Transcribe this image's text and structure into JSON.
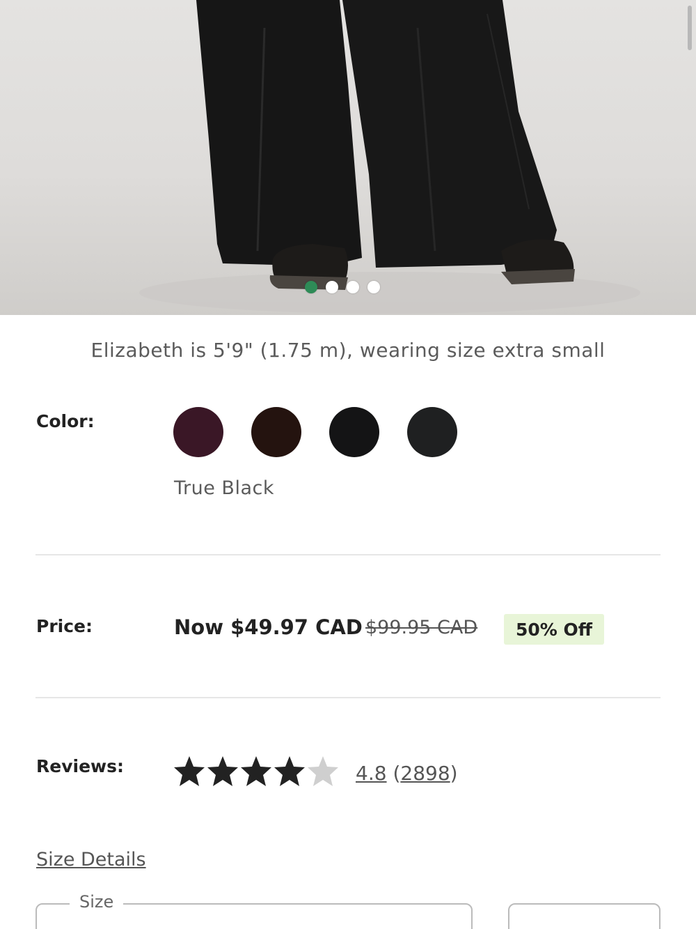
{
  "product_image": {
    "alt_label": "product-photo",
    "carousel": {
      "total": 4,
      "active": 1
    }
  },
  "caption": "Elizabeth is 5'9\" (1.75 m), wearing size extra small",
  "color": {
    "label": "Color:",
    "selected_name": "True Black",
    "swatches": [
      {
        "name": "plum",
        "hex": "#3a1726"
      },
      {
        "name": "brown",
        "hex": "#24130f"
      },
      {
        "name": "True Black",
        "hex": "#141415",
        "selected": true
      },
      {
        "name": "charcoal",
        "hex": "#1f2021"
      }
    ]
  },
  "price": {
    "label": "Price:",
    "now": "Now $49.97 CAD",
    "was": "$99.95 CAD",
    "badge": "50% Off"
  },
  "reviews": {
    "label": "Reviews:",
    "rating": "4.8",
    "count": "(2898)",
    "count_open": "(",
    "count_number": "2898",
    "count_close": ")",
    "stars_value": 4.8
  },
  "size": {
    "details_link": "Size Details",
    "field_label": "Size"
  },
  "colors": {
    "accent_dot": "#2e8b57",
    "badge_bg": "#e8f5d8"
  }
}
